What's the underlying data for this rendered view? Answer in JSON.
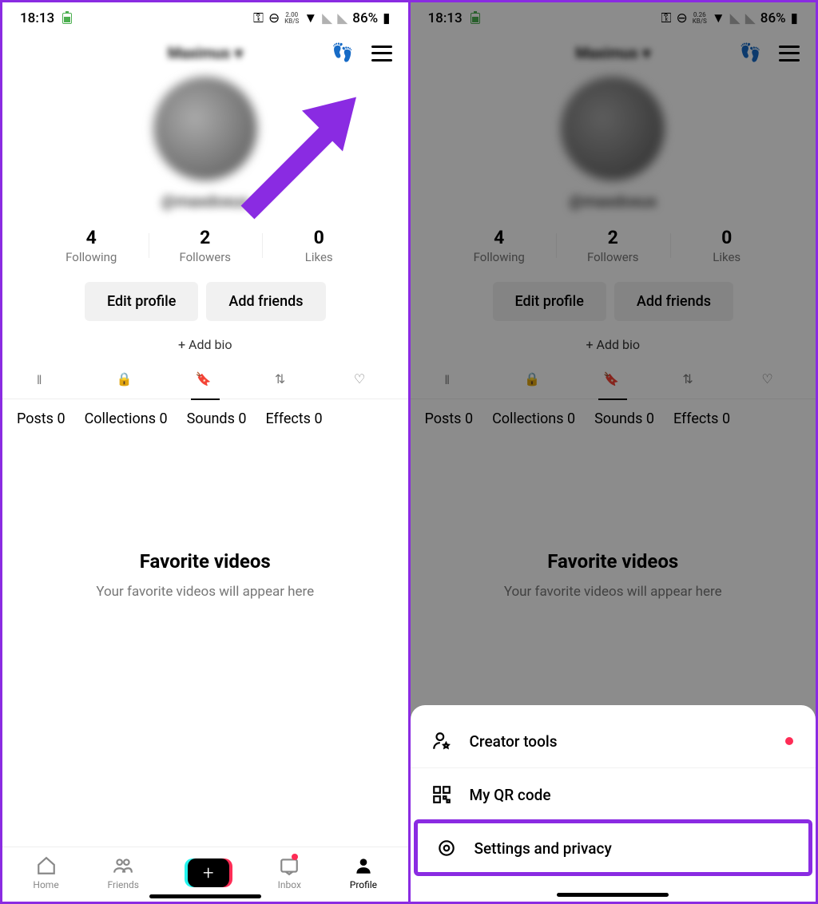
{
  "status": {
    "time": "18:13",
    "speed_value_left": "2.00",
    "speed_unit_left": "KB/S",
    "speed_value_right": "0.26",
    "speed_unit_right": "KB/S",
    "battery_percent": "86%"
  },
  "profile": {
    "username": "Maximus",
    "handle": "@maxdoxus"
  },
  "stats": {
    "following_value": "4",
    "following_label": "Following",
    "followers_value": "2",
    "followers_label": "Followers",
    "likes_value": "0",
    "likes_label": "Likes"
  },
  "buttons": {
    "edit_profile": "Edit profile",
    "add_friends": "Add friends",
    "add_bio": "+ Add bio"
  },
  "sub_tabs": {
    "posts": "Posts 0",
    "collections": "Collections 0",
    "sounds": "Sounds 0",
    "effects": "Effects 0"
  },
  "empty": {
    "title": "Favorite videos",
    "subtitle": "Your favorite videos will appear here"
  },
  "nav": {
    "home": "Home",
    "friends": "Friends",
    "inbox": "Inbox",
    "profile": "Profile"
  },
  "sheet": {
    "creator_tools": "Creator tools",
    "qr_code": "My QR code",
    "settings": "Settings and privacy"
  }
}
